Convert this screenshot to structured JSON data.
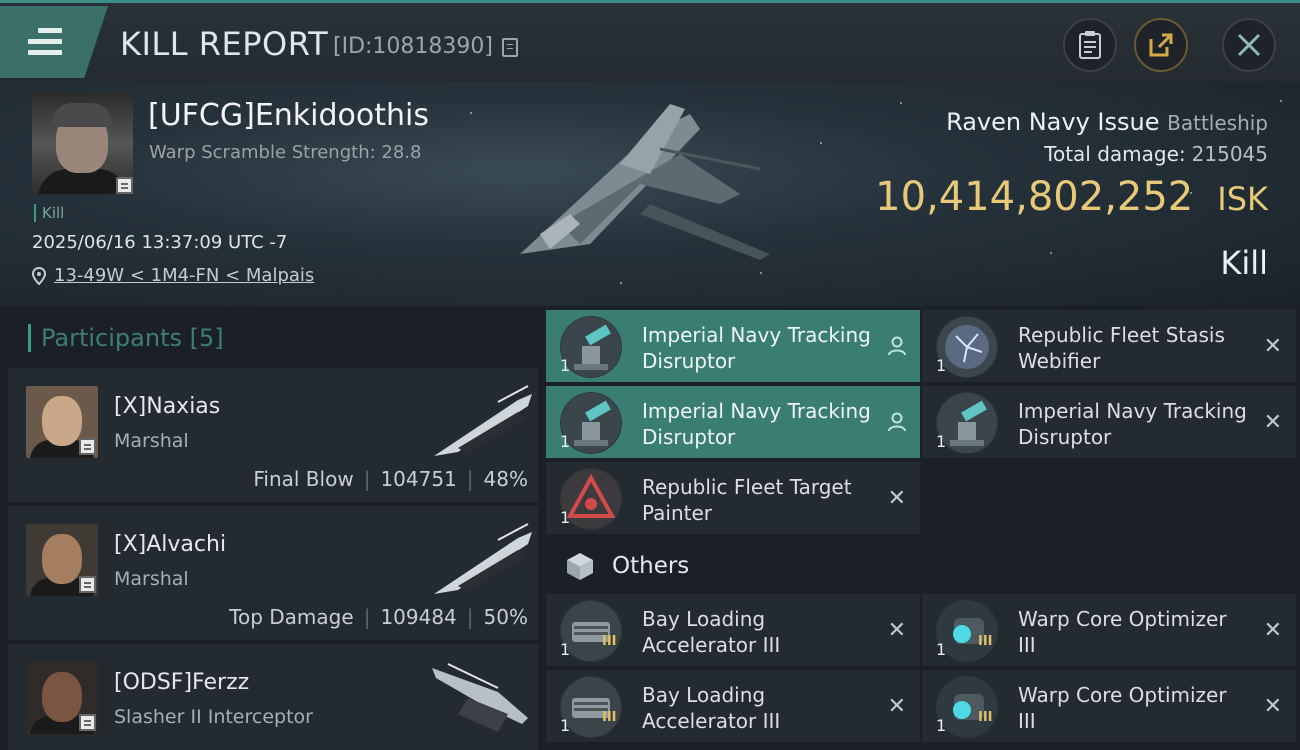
{
  "header": {
    "title": "KILL REPORT",
    "report_id": "[ID:10818390]"
  },
  "victim": {
    "name": "[UFCG]Enkidoothis",
    "warp_scramble": "Warp Scramble Strength: 28.8",
    "kill_tag": "Kill",
    "timestamp": "2025/06/16 13:37:09 UTC -7",
    "location": "13-49W < 1M4-FN < Malpais",
    "ship_name": "Raven Navy Issue",
    "ship_class": "Battleship",
    "total_damage_label": "Total damage:",
    "total_damage": "215045",
    "isk_value": "10,414,802,252",
    "isk_unit": "ISK",
    "result": "Kill"
  },
  "participants": {
    "title": "Participants",
    "count": "[5]",
    "rows": [
      {
        "name": "[X]Naxias",
        "ship": "Marshal",
        "role": "Final Blow",
        "damage": "104751",
        "percent": "48%"
      },
      {
        "name": "[X]Alvachi",
        "ship": "Marshal",
        "role": "Top Damage",
        "damage": "109484",
        "percent": "50%"
      },
      {
        "name": "[ODSF]Ferzz",
        "ship": "Slasher II Interceptor"
      }
    ]
  },
  "modules": {
    "items": [
      {
        "qty": "1",
        "name": "Imperial Navy Tracking Disruptor",
        "selected": true,
        "action": "person-icon"
      },
      {
        "qty": "1",
        "name": "Republic Fleet Stasis Webifier",
        "selected": false,
        "action": "close-icon"
      },
      {
        "qty": "1",
        "name": "Imperial Navy Tracking Disruptor",
        "selected": true,
        "action": "person-icon"
      },
      {
        "qty": "1",
        "name": "Imperial Navy Tracking Disruptor",
        "selected": false,
        "action": "close-icon"
      },
      {
        "qty": "1",
        "name": "Republic Fleet Target Painter",
        "selected": false,
        "action": "close-icon"
      }
    ],
    "others_label": "Others",
    "others": [
      {
        "qty": "1",
        "name": "Bay Loading Accelerator III",
        "tier": "III"
      },
      {
        "qty": "1",
        "name": "Warp Core Optimizer III",
        "tier": "III"
      },
      {
        "qty": "1",
        "name": "Bay Loading Accelerator III",
        "tier": "III"
      },
      {
        "qty": "1",
        "name": "Warp Core Optimizer III",
        "tier": "III"
      }
    ]
  },
  "colors": {
    "accent": "#3a7d72",
    "isk": "#e7c977"
  }
}
